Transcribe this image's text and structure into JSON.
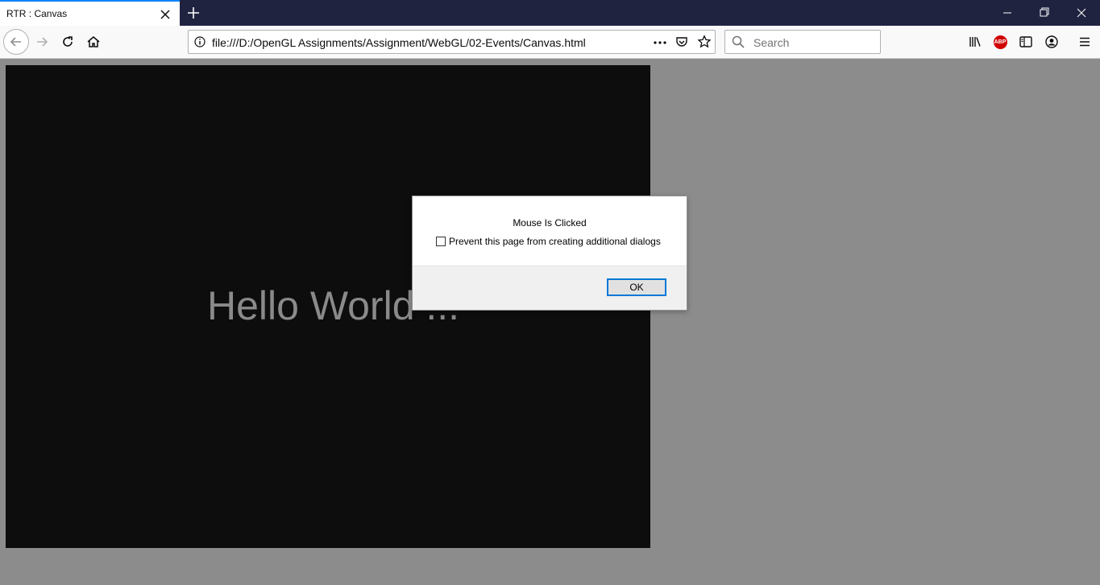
{
  "tab": {
    "title": "RTR : Canvas"
  },
  "navbar": {
    "url": "file:///D:/OpenGL Assignments/Assignment/WebGL/02-Events/Canvas.html",
    "search_placeholder": "Search",
    "abp_label": "ABP"
  },
  "canvas": {
    "text": "Hello World ..."
  },
  "dialog": {
    "message": "Mouse Is Clicked",
    "checkbox_label": "Prevent this page from creating additional dialogs",
    "checkbox_checked": false,
    "ok_label": "OK"
  },
  "colors": {
    "tabstrip": "#202340",
    "tab_accent": "#0a84ff",
    "page_background": "#8c8c8c",
    "canvas_background": "#0d0d0d",
    "canvas_text": "#8a8a8a",
    "ok_border": "#0078d7",
    "abp_red": "#d00000"
  },
  "icons": {
    "tab_close": "close-icon",
    "new_tab": "plus-icon",
    "back": "back-arrow-icon",
    "forward": "forward-arrow-icon",
    "reload": "reload-icon",
    "home": "home-icon",
    "site_info": "info-icon",
    "page_actions": "more-icon",
    "pocket": "pocket-icon",
    "bookmark": "star-icon",
    "search": "search-icon",
    "library": "library-icon",
    "adblock": "abp-icon",
    "sidebar": "sidebar-icon",
    "account": "account-icon",
    "menu": "hamburger-icon"
  }
}
